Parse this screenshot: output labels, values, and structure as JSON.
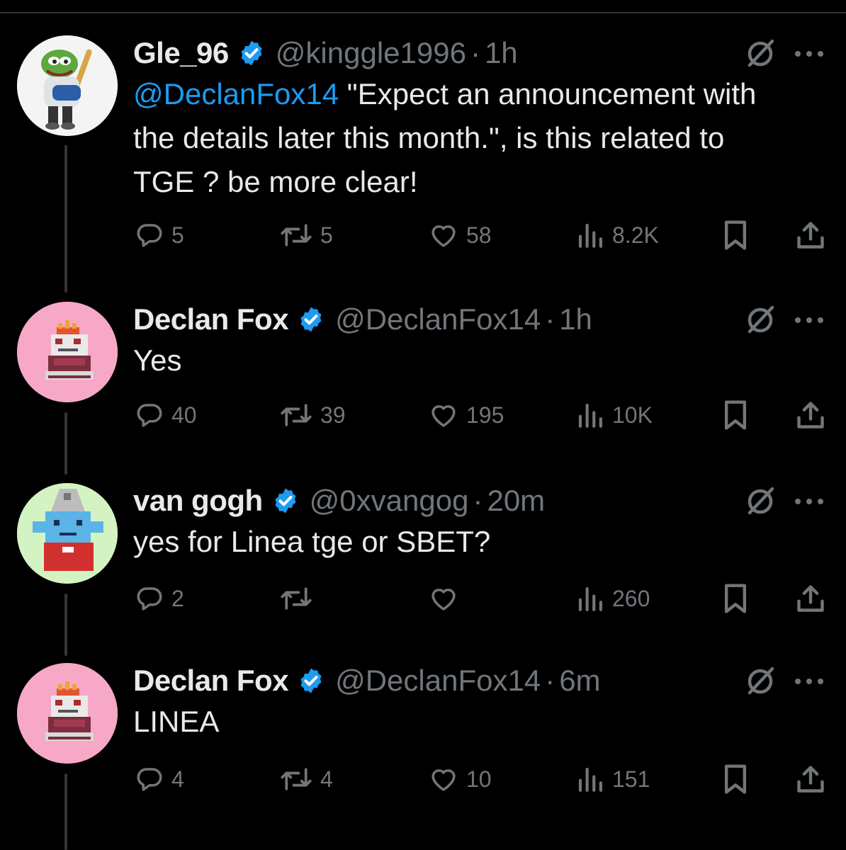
{
  "posts": [
    {
      "name": "Gle_96",
      "handle": "@kinggle1996",
      "dot": "·",
      "time": "1h",
      "mention": "@DeclanFox14",
      "text": " \"Expect an announcement with the details later this month.\", is this related to TGE ? be more clear!",
      "replies": "5",
      "reposts": "5",
      "likes": "58",
      "views": "8.2K",
      "avatar": "pepe-baseball-avatar"
    },
    {
      "name": "Declan Fox",
      "handle": "@DeclanFox14",
      "dot": "·",
      "time": "1h",
      "mention": "",
      "text": "Yes",
      "replies": "40",
      "reposts": "39",
      "likes": "195",
      "views": "10K",
      "avatar": "pixel-frog-crown-avatar"
    },
    {
      "name": "van gogh",
      "handle": "@0xvangog",
      "dot": "·",
      "time": "20m",
      "mention": "",
      "text": "yes for Linea tge or SBET?",
      "replies": "2",
      "reposts": "",
      "likes": "",
      "views": "260",
      "avatar": "pixel-creature-helmet-avatar"
    },
    {
      "name": "Declan Fox",
      "handle": "@DeclanFox14",
      "dot": "·",
      "time": "6m",
      "mention": "",
      "text": "LINEA",
      "replies": "4",
      "reposts": "4",
      "likes": "10",
      "views": "151",
      "avatar": "pixel-frog-crown-avatar"
    }
  ],
  "icons": {
    "reply": "reply-icon",
    "repost": "repost-icon",
    "like": "like-icon",
    "views": "views-icon",
    "bookmark": "bookmark-icon",
    "share": "share-icon",
    "grok": "grok-icon",
    "more": "more-icon",
    "verified": "verified-badge-icon"
  },
  "colors": {
    "background": "#000000",
    "text": "#e7e9ea",
    "secondary": "#71767b",
    "accent": "#1d9bf0",
    "thread_line": "#333639"
  }
}
